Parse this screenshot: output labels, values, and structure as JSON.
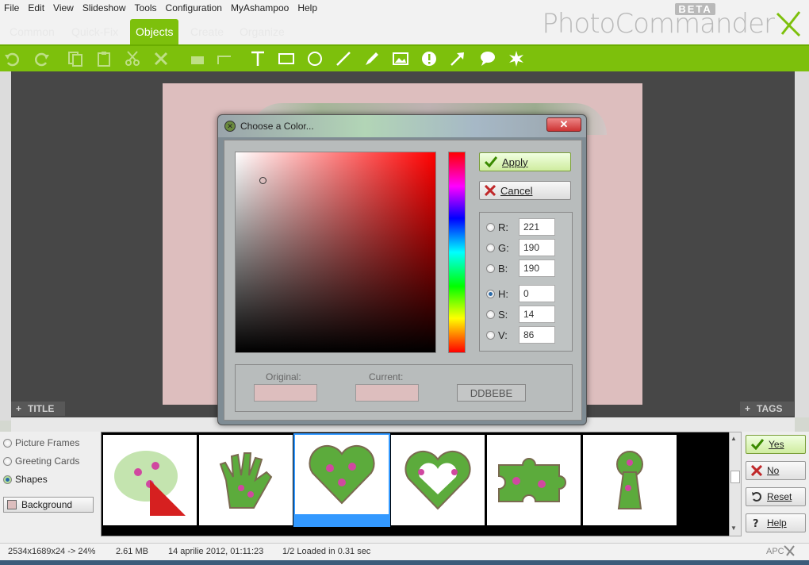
{
  "menu": [
    "File",
    "Edit",
    "View",
    "Slideshow",
    "Tools",
    "Configuration",
    "MyAshampoo",
    "Help"
  ],
  "logo": {
    "text": "PhotoCommander",
    "badge": "BETA"
  },
  "tabs": [
    "Common",
    "Quick-Fix",
    "Objects",
    "Create",
    "Organize"
  ],
  "active_tab": "Objects",
  "toolbar_icons": [
    "undo-icon",
    "redo-icon",
    "copy-icon",
    "paste-icon",
    "cut-icon",
    "delete-icon",
    "bring-front-icon",
    "send-back-icon",
    "text-icon",
    "rectangle-icon",
    "ellipse-icon",
    "line-icon",
    "pen-icon",
    "image-icon",
    "exclamation-icon",
    "arrow-icon",
    "speech-bubble-icon",
    "star-icon"
  ],
  "canvas": {
    "title_label": "TITLE",
    "tags_label": "TAGS"
  },
  "dialog": {
    "title": "Choose a Color...",
    "apply_label": "Apply",
    "cancel_label": "Cancel",
    "fields": [
      {
        "label": "R:",
        "value": "221"
      },
      {
        "label": "G:",
        "value": "190"
      },
      {
        "label": "B:",
        "value": "190"
      },
      {
        "label": "H:",
        "value": "0"
      },
      {
        "label": "S:",
        "value": "14"
      },
      {
        "label": "V:",
        "value": "86"
      }
    ],
    "selected_field": "H:",
    "original_label": "Original:",
    "current_label": "Current:",
    "hex": "DDBEBE",
    "color": "#ddbebe"
  },
  "options": {
    "items": [
      "Picture Frames",
      "Greeting Cards",
      "Shapes"
    ],
    "selected": "Shapes",
    "background_label": "Background"
  },
  "actions": {
    "yes": "Yes",
    "no": "No",
    "reset": "Reset",
    "help": "Help"
  },
  "status": {
    "dims": "2534x1689x24 -> 24%",
    "size": "2.61 MB",
    "date": "14 aprilie 2012, 01:11:23",
    "info": "1/2  Loaded in 0.31 sec",
    "brand": "APC"
  },
  "colors": {
    "accent": "#7dc00c",
    "canvas": "#474747",
    "selection": "#3399ff"
  }
}
